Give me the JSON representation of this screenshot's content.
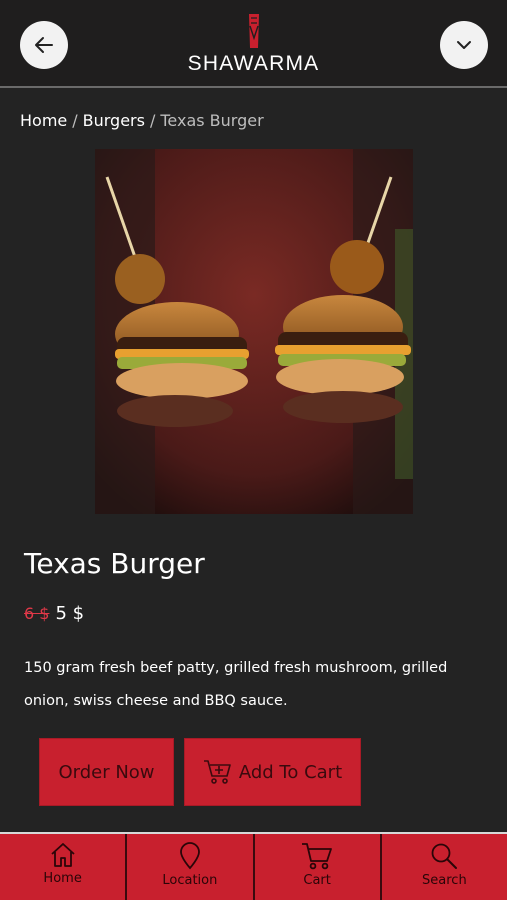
{
  "header": {
    "logo_text": "SHAWARMA",
    "back_icon": "arrow-left-icon",
    "menu_icon": "chevron-down-icon"
  },
  "breadcrumb": {
    "home": "Home",
    "category": "Burgers",
    "current": "Texas Burger",
    "separator": "/"
  },
  "product": {
    "name": "Texas Burger",
    "old_price": "6 $",
    "price": "5 $",
    "description": "150 gram fresh beef patty, grilled fresh mushroom, grilled onion, swiss cheese and BBQ sauce."
  },
  "actions": {
    "order_label": "Order Now",
    "cart_label": "Add To Cart"
  },
  "tabs": [
    {
      "label": "Home",
      "icon": "home-icon"
    },
    {
      "label": "Location",
      "icon": "location-pin-icon"
    },
    {
      "label": "Cart",
      "icon": "cart-icon"
    },
    {
      "label": "Search",
      "icon": "search-icon"
    }
  ],
  "colors": {
    "brand_red": "#c8202e",
    "background": "#232323",
    "header": "#1f1e1e",
    "strike_price": "#e03848"
  }
}
